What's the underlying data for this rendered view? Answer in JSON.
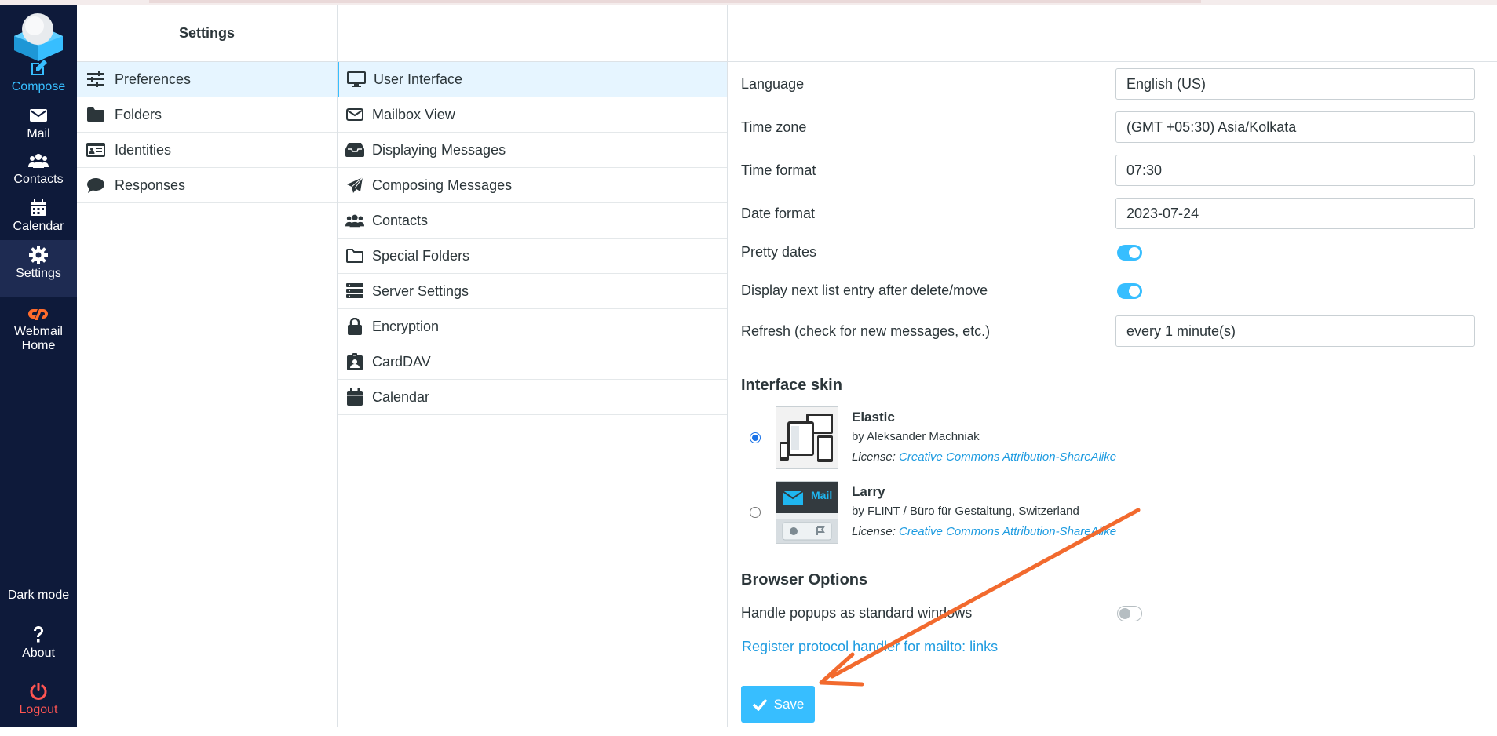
{
  "nav": {
    "items": [
      {
        "label": "Compose",
        "icon": "compose-icon"
      },
      {
        "label": "Mail",
        "icon": "envelope-icon"
      },
      {
        "label": "Contacts",
        "icon": "users-icon"
      },
      {
        "label": "Calendar",
        "icon": "calendar-icon"
      },
      {
        "label": "Settings",
        "icon": "gear-icon"
      },
      {
        "label": "Webmail Home",
        "icon": "cpanel-icon"
      }
    ],
    "bottom": [
      {
        "label": "Dark mode",
        "icon": "moon-icon"
      },
      {
        "label": "About",
        "icon": "question-icon"
      },
      {
        "label": "Logout",
        "icon": "power-icon"
      }
    ],
    "accent": "#37beff",
    "logout_color": "#ff5552"
  },
  "settings": {
    "title": "Settings",
    "sections": [
      {
        "label": "Preferences",
        "icon": "sliders-icon"
      },
      {
        "label": "Folders",
        "icon": "folder-icon"
      },
      {
        "label": "Identities",
        "icon": "id-card-icon"
      },
      {
        "label": "Responses",
        "icon": "comment-icon"
      }
    ]
  },
  "prefs": {
    "items": [
      {
        "label": "User Interface",
        "icon": "monitor-icon"
      },
      {
        "label": "Mailbox View",
        "icon": "envelope-icon"
      },
      {
        "label": "Displaying Messages",
        "icon": "inbox-icon"
      },
      {
        "label": "Composing Messages",
        "icon": "paper-plane-icon"
      },
      {
        "label": "Contacts",
        "icon": "users-icon"
      },
      {
        "label": "Special Folders",
        "icon": "folder-outline-icon"
      },
      {
        "label": "Server Settings",
        "icon": "server-icon"
      },
      {
        "label": "Encryption",
        "icon": "lock-icon"
      },
      {
        "label": "CardDAV",
        "icon": "badge-icon"
      },
      {
        "label": "Calendar",
        "icon": "calendar-icon"
      }
    ]
  },
  "form": {
    "language": {
      "label": "Language",
      "value": "English (US)"
    },
    "timezone": {
      "label": "Time zone",
      "value": "(GMT +05:30) Asia/Kolkata"
    },
    "timeformat": {
      "label": "Time format",
      "value": "07:30"
    },
    "dateformat": {
      "label": "Date format",
      "value": "2023-07-24"
    },
    "prettydates": {
      "label": "Pretty dates",
      "on": true
    },
    "nextentry": {
      "label": "Display next list entry after delete/move",
      "on": true
    },
    "refresh": {
      "label": "Refresh (check for new messages, etc.)",
      "value": "every 1 minute(s)"
    },
    "skin_title": "Interface skin",
    "skins": [
      {
        "name": "Elastic",
        "author": "by Aleksander Machniak",
        "license_label": "License:",
        "license": "Creative Commons Attribution-ShareAlike",
        "selected": true
      },
      {
        "name": "Larry",
        "author": "by FLINT / Büro für Gestaltung, Switzerland",
        "license_label": "License:",
        "license": "Creative Commons Attribution-ShareAlike",
        "selected": false
      }
    ],
    "larry_thumb_text": "Mail",
    "browser_title": "Browser Options",
    "popups": {
      "label": "Handle popups as standard windows",
      "on": false
    },
    "register_link": "Register protocol handler for mailto: links",
    "save_label": "Save"
  }
}
